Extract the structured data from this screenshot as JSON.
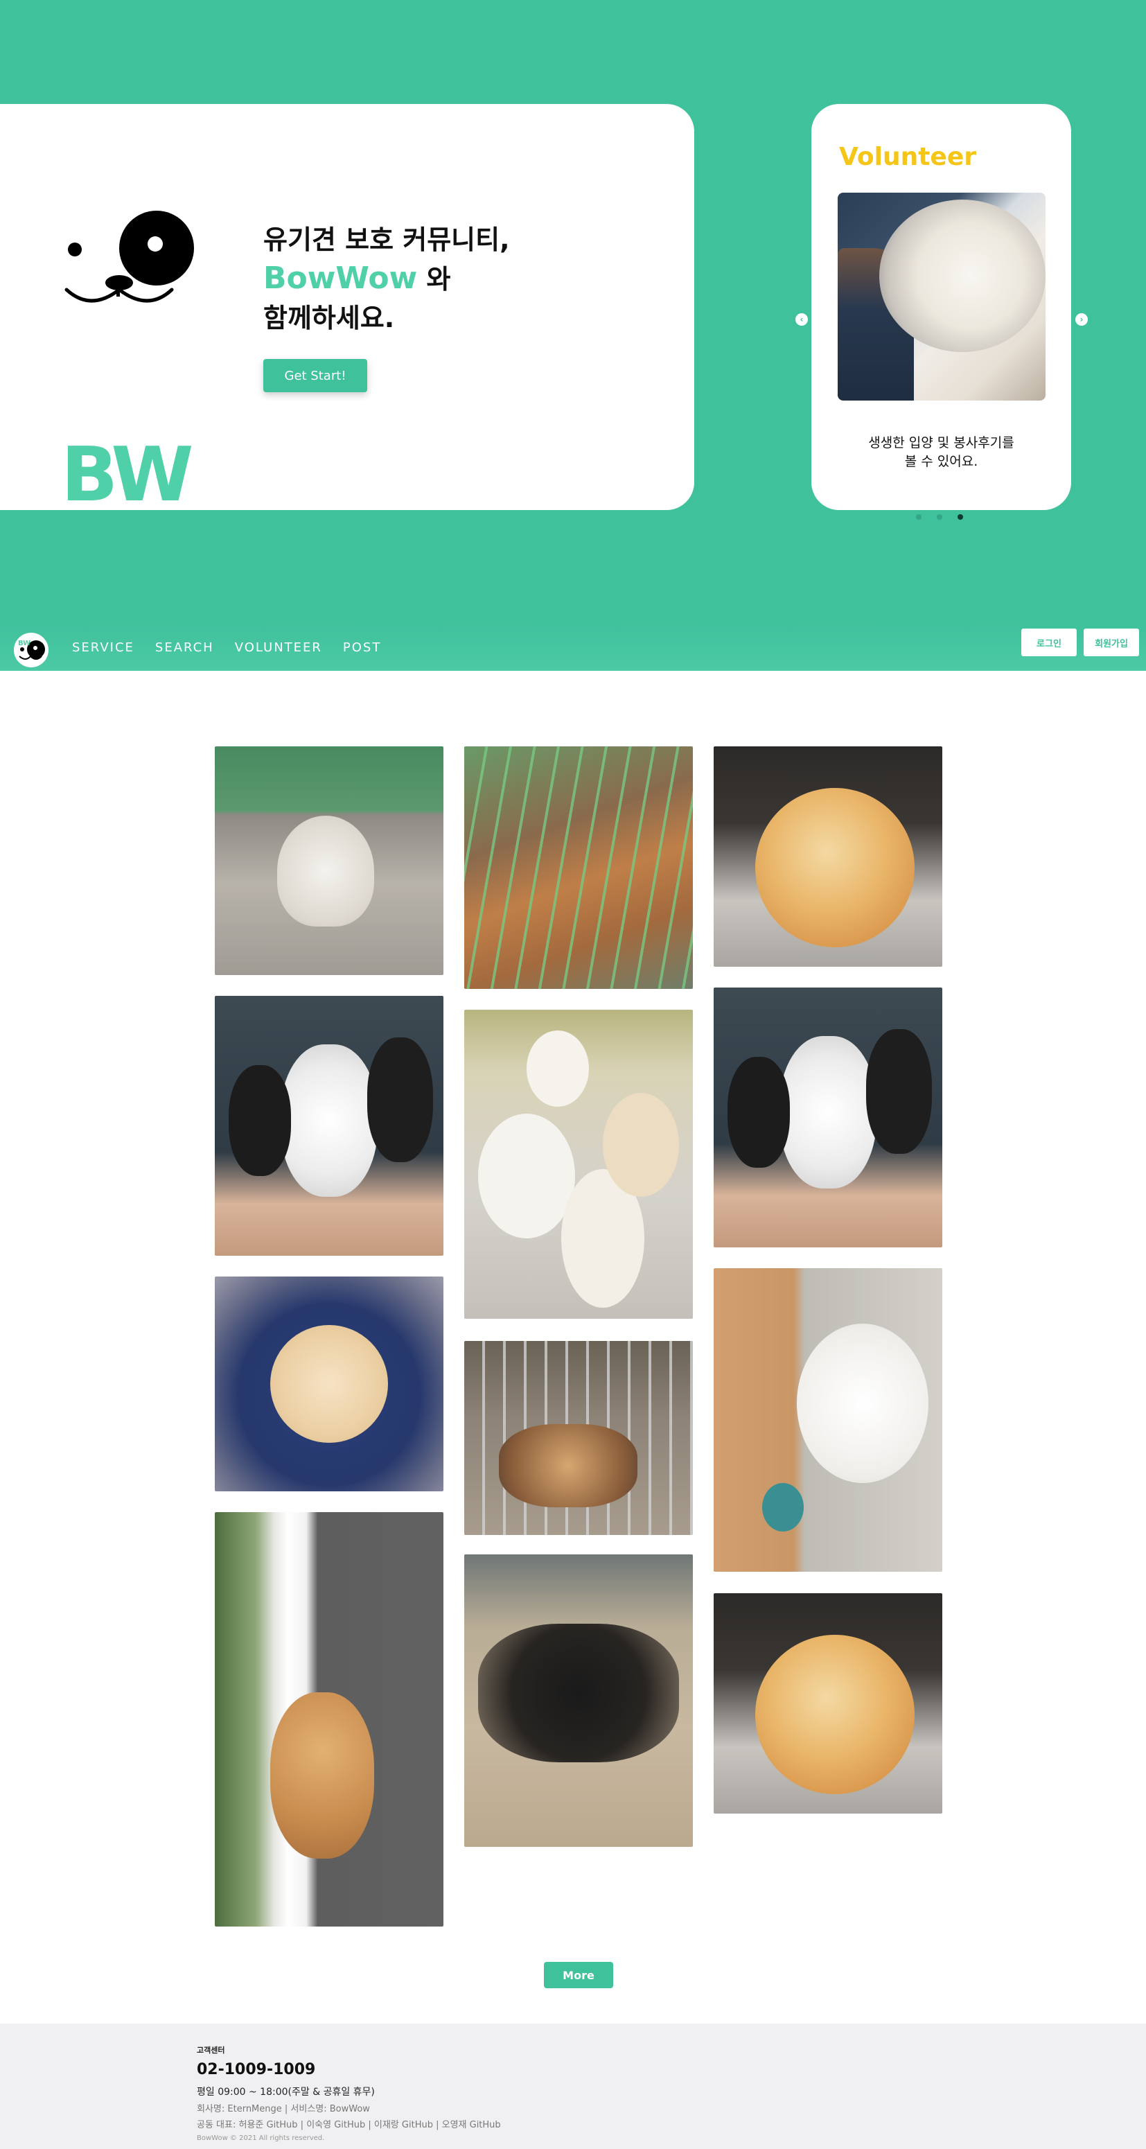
{
  "hero": {
    "logo_text": "BW",
    "headline_line1": "유기견 보호 커뮤니티,",
    "brand": "BowWow",
    "headline_line2_suffix": " 와",
    "headline_line3": "함께하세요.",
    "start_button": "Get Start!"
  },
  "volunteer_card": {
    "title": "Volunteer",
    "caption_line1": "생생한 입양 및 봉사후기를",
    "caption_line2": "볼 수 있어요.",
    "arrow_left": "‹",
    "arrow_right": "›",
    "slides": 3,
    "active_slide": 3
  },
  "nav": {
    "logo_text": "BW",
    "links": [
      "SERVICE",
      "SEARCH",
      "VOLUNTEER",
      "POST"
    ],
    "login": "로그인",
    "signup": "회원가입"
  },
  "gallery": {
    "more_button": "More",
    "photos": [
      {
        "subject": "white fluffy dog in shelter yard"
      },
      {
        "subject": "puppies behind green fence"
      },
      {
        "subject": "pomeranian lying on blanket"
      },
      {
        "subject": "person holding three puppies"
      },
      {
        "subject": "group of white puppies"
      },
      {
        "subject": "person holding three puppies"
      },
      {
        "subject": "puppy sleeping in dog bed"
      },
      {
        "subject": "puppies in metal cage"
      },
      {
        "subject": "white poodle on rug"
      },
      {
        "subject": "shiba dog sitting by flowers"
      },
      {
        "subject": "many black dogs in dirt yard"
      },
      {
        "subject": "pomeranian lying on blanket"
      }
    ]
  },
  "footer": {
    "label": "고객센터",
    "phone": "02-1009-1009",
    "hours": "평일 09:00 ~ 18:00(주말 & 공휴일 휴무)",
    "company": "회사명: EternMenge | 서비스명: BowWow",
    "reps": "공동 대표: 허용준 GitHub | 이숙영 GitHub | 이재랑 GitHub | 오영재 GitHub",
    "copyright": "BowWow © 2021 All rights reserved."
  },
  "colors": {
    "brand_green": "#3fc19c",
    "logo_green": "#4fd0a8",
    "volunteer_yellow": "#f5c518"
  }
}
